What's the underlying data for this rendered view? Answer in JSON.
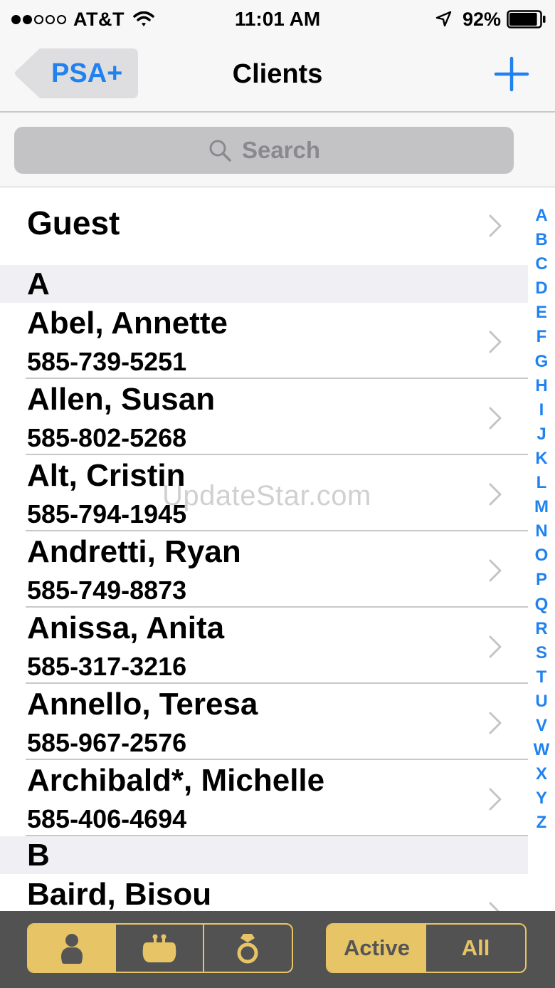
{
  "status_bar": {
    "carrier": "AT&T",
    "time": "11:01 AM",
    "battery": "92%",
    "battery_level": 0.92,
    "signal_bars_filled": 2,
    "signal_bars_total": 5
  },
  "nav": {
    "back_label": "PSA+",
    "title": "Clients",
    "add_icon": "plus-icon"
  },
  "search": {
    "placeholder": "Search",
    "icon": "search-icon"
  },
  "guest": {
    "label": "Guest"
  },
  "sections": [
    {
      "letter": "A",
      "clients": [
        {
          "name": "Abel, Annette",
          "phone": "585-739-5251"
        },
        {
          "name": "Allen, Susan",
          "phone": "585-802-5268"
        },
        {
          "name": "Alt, Cristin",
          "phone": "585-794-1945"
        },
        {
          "name": "Andretti, Ryan",
          "phone": "585-749-8873"
        },
        {
          "name": "Anissa, Anita",
          "phone": "585-317-3216"
        },
        {
          "name": "Annello, Teresa",
          "phone": "585-967-2576"
        },
        {
          "name": "Archibald*, Michelle",
          "phone": "585-406-4694"
        }
      ]
    },
    {
      "letter": "B",
      "clients": [
        {
          "name": "Baird, Bisou",
          "phone": ""
        }
      ]
    }
  ],
  "index_letters": [
    "A",
    "B",
    "C",
    "D",
    "E",
    "F",
    "G",
    "H",
    "I",
    "J",
    "K",
    "L",
    "M",
    "N",
    "O",
    "P",
    "Q",
    "R",
    "S",
    "T",
    "U",
    "V",
    "W",
    "X",
    "Y",
    "Z"
  ],
  "watermark": "UpdateStar.com",
  "toolbar": {
    "type_segments": [
      {
        "icon": "person-icon",
        "selected": true
      },
      {
        "icon": "purse-icon",
        "selected": false
      },
      {
        "icon": "ring-icon",
        "selected": false
      }
    ],
    "filter_segments": [
      {
        "label": "Active",
        "selected": true
      },
      {
        "label": "All",
        "selected": false
      }
    ]
  },
  "colors": {
    "accent": "#1f82f0",
    "toolbar_bg": "#525252",
    "segment_gold": "#e7c566",
    "section_bg": "#efeff4"
  }
}
